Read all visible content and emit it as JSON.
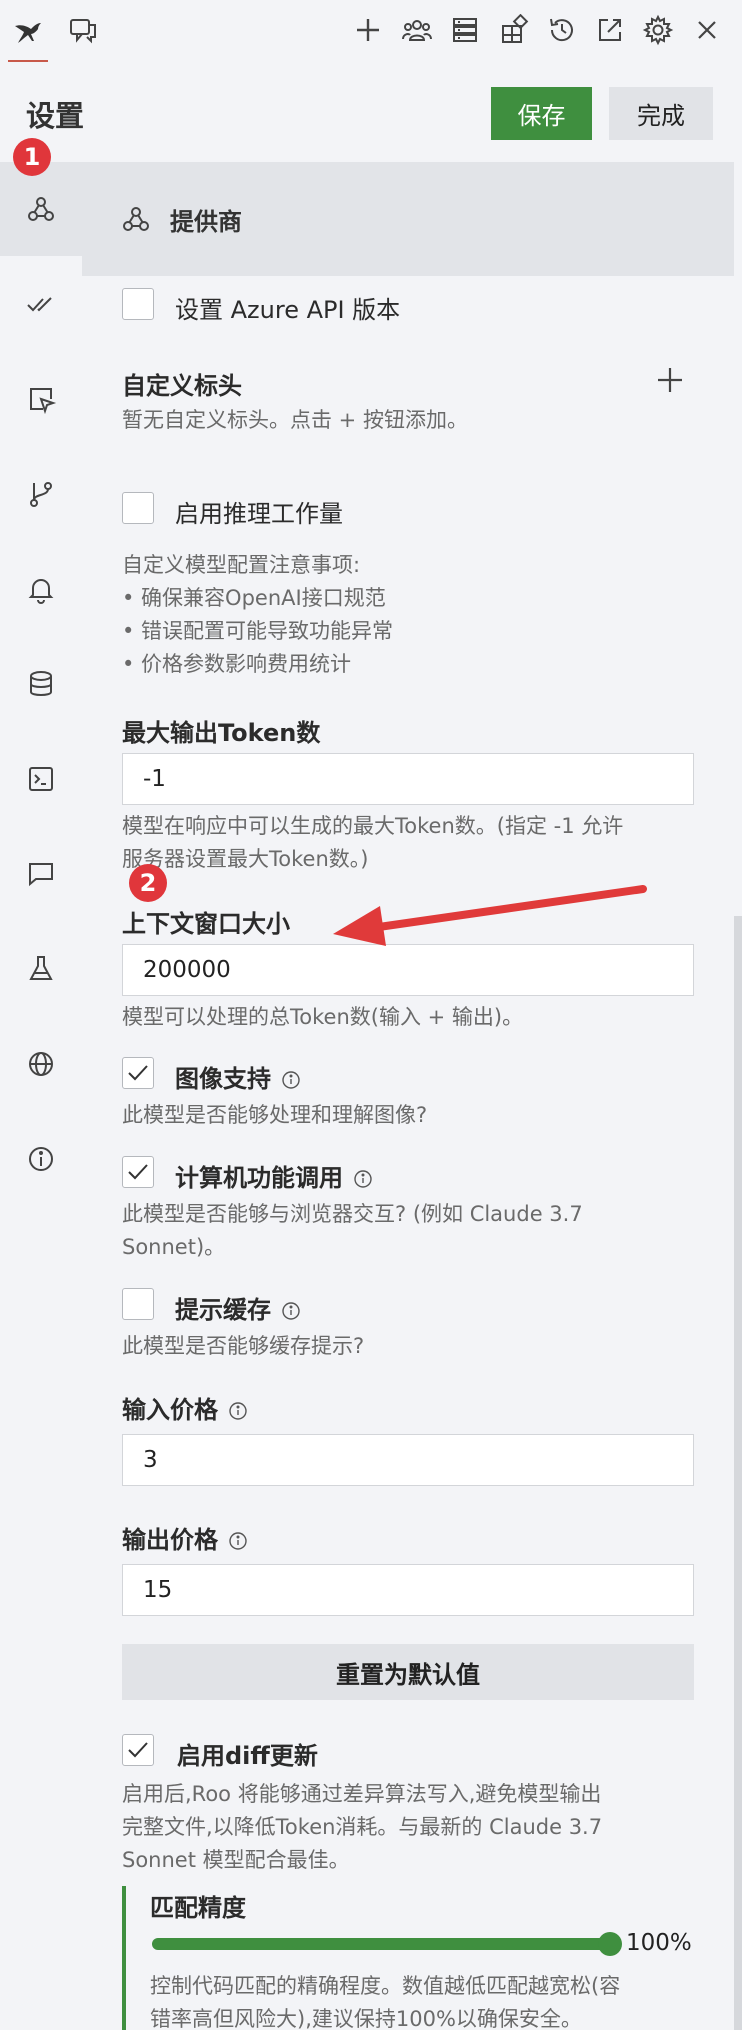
{
  "header": {
    "title": "设置",
    "save_label": "保存",
    "done_label": "完成"
  },
  "badges": {
    "one": "1",
    "two": "2"
  },
  "section": {
    "title": "提供商"
  },
  "azure": {
    "label": "设置 Azure API 版本"
  },
  "custom_headers": {
    "title": "自定义标头",
    "empty": "暂无自定义标头。点击 + 按钮添加。"
  },
  "reasoning": {
    "label": "启用推理工作量"
  },
  "notes": {
    "title": "自定义模型配置注意事项:",
    "items": [
      "• 确保兼容OpenAI接口规范",
      "• 错误配置可能导致功能异常",
      "• 价格参数影响费用统计"
    ]
  },
  "max_tokens": {
    "label": "最大输出Token数",
    "value": "-1",
    "desc_1": "模型在响应中可以生成的最大Token数。(指定 -1 允许",
    "desc_2": "服务器设置最大Token数。)"
  },
  "context_window": {
    "label": "上下文窗口大小",
    "value": "200000",
    "desc": "模型可以处理的总Token数(输入 + 输出)。"
  },
  "image_support": {
    "label": "图像支持",
    "desc": "此模型是否能够处理和理解图像?",
    "checked": true
  },
  "computer_use": {
    "label": "计算机功能调用",
    "desc_1": "此模型是否能够与浏览器交互? (例如 Claude 3.7",
    "desc_2": "Sonnet)。",
    "checked": true
  },
  "prompt_cache": {
    "label": "提示缓存",
    "desc": "此模型是否能够缓存提示?",
    "checked": false
  },
  "input_price": {
    "label": "输入价格",
    "value": "3"
  },
  "output_price": {
    "label": "输出价格",
    "value": "15"
  },
  "reset": {
    "label": "重置为默认值"
  },
  "diff": {
    "label": "启用diff更新",
    "desc_1": "启用后,Roo 将能够通过差异算法写入,避免模型输出",
    "desc_2": "完整文件,以降低Token消耗。与最新的 Claude 3.7",
    "desc_3": "Sonnet 模型配合最佳。",
    "checked": true
  },
  "match_precision": {
    "label": "匹配精度",
    "value": "100%",
    "level": 1.0,
    "desc_1": "控制代码匹配的精确程度。数值越低匹配越宽松(容",
    "desc_2": "错率高但风险大),建议保持100%以确保安全。"
  },
  "colors": {
    "accent": "#3f8f3f",
    "badge": "#e0363b",
    "arrow": "#e03a3a"
  }
}
